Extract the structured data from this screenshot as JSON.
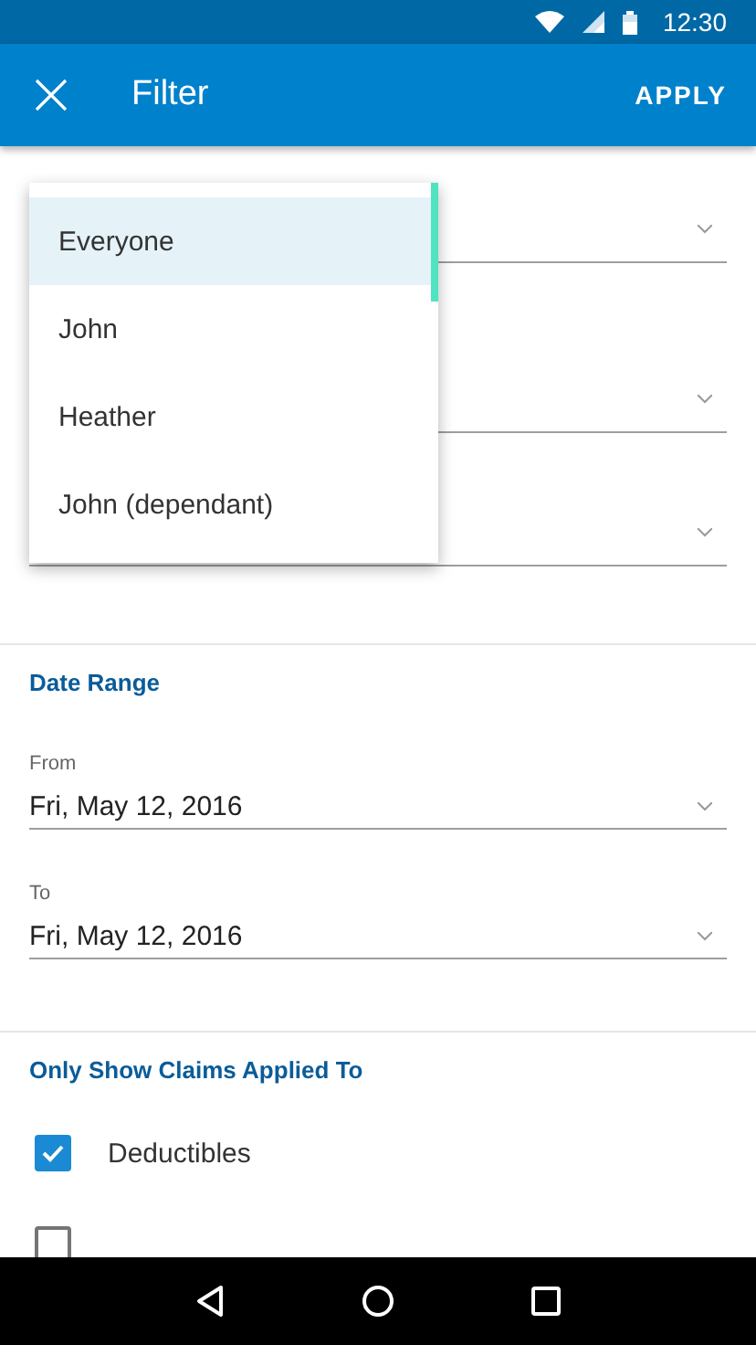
{
  "status_bar": {
    "time": "12:30"
  },
  "app_bar": {
    "title": "Filter",
    "action": "APPLY"
  },
  "dropdown_menu": {
    "items": [
      {
        "label": "Everyone",
        "selected": true
      },
      {
        "label": "John",
        "selected": false
      },
      {
        "label": "Heather",
        "selected": false
      },
      {
        "label": "John (dependant)",
        "selected": false
      }
    ]
  },
  "date_range": {
    "title": "Date Range",
    "fields": [
      {
        "label": "From",
        "value": "Fri, May 12, 2016"
      },
      {
        "label": "To",
        "value": "Fri, May 12, 2016"
      }
    ]
  },
  "claims_filter": {
    "title": "Only Show Claims Applied To",
    "options": [
      {
        "label": "Deductibles",
        "checked": true
      },
      {
        "checked": false
      }
    ]
  }
}
